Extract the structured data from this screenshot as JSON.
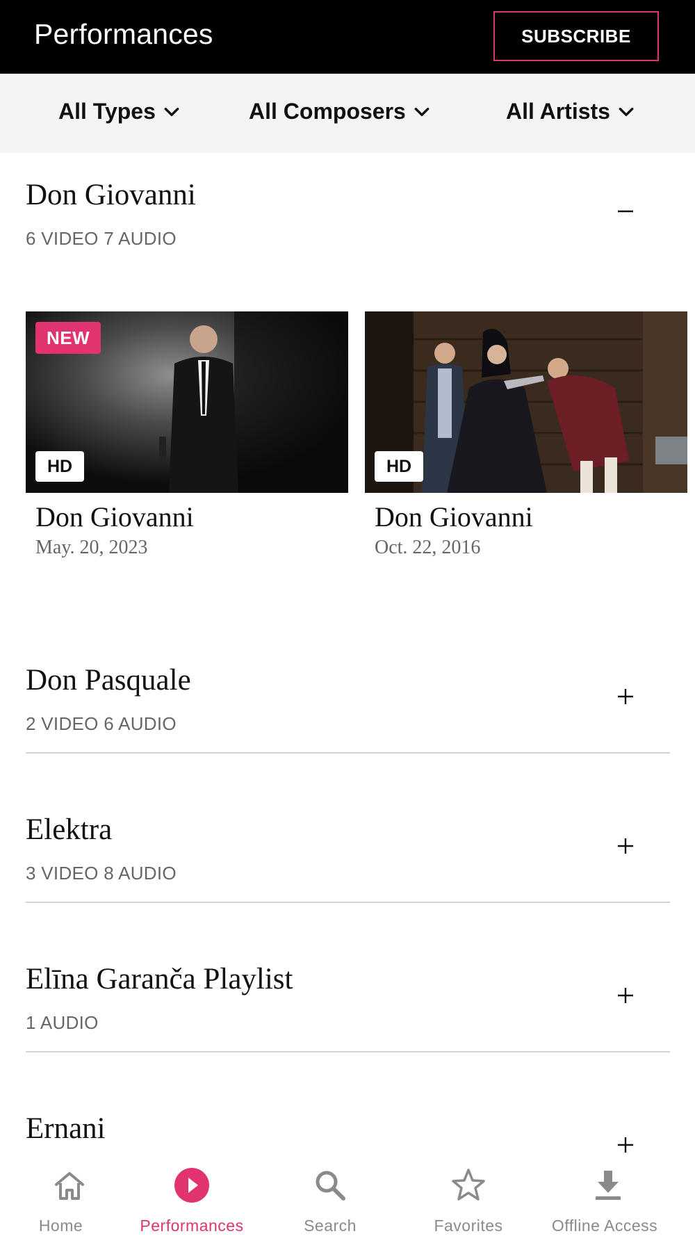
{
  "header": {
    "title": "Performances",
    "subscribe_label": "SUBSCRIBE"
  },
  "filters": [
    {
      "label": "All Types",
      "icon": "chevron-down-icon"
    },
    {
      "label": "All Composers",
      "icon": "chevron-down-icon"
    },
    {
      "label": "All Artists",
      "icon": "chevron-down-icon"
    }
  ],
  "sections": [
    {
      "title": "Don Giovanni",
      "subtitle": "6 VIDEO 7 AUDIO",
      "expanded": true,
      "toggle": "minus-icon",
      "cards": [
        {
          "badge_new": "NEW",
          "quality": "HD",
          "title": "Don Giovanni",
          "date": "May. 20, 2023"
        },
        {
          "quality": "HD",
          "title": "Don Giovanni",
          "date": "Oct. 22, 2016"
        }
      ]
    },
    {
      "title": "Don Pasquale",
      "subtitle": "2 VIDEO 6 AUDIO",
      "expanded": false,
      "toggle": "plus-icon"
    },
    {
      "title": "Elektra",
      "subtitle": "3 VIDEO 8 AUDIO",
      "expanded": false,
      "toggle": "plus-icon"
    },
    {
      "title": "Elīna Garanča Playlist",
      "subtitle": "1 AUDIO",
      "expanded": false,
      "toggle": "plus-icon"
    },
    {
      "title": "Ernani",
      "expanded": false,
      "toggle": "plus-icon"
    }
  ],
  "bottom_nav": [
    {
      "label": "Home",
      "icon": "home-icon",
      "active": false
    },
    {
      "label": "Performances",
      "icon": "play-circle-icon",
      "active": true
    },
    {
      "label": "Search",
      "icon": "search-icon",
      "active": false
    },
    {
      "label": "Favorites",
      "icon": "star-icon",
      "active": false
    },
    {
      "label": "Offline Access",
      "icon": "download-icon",
      "active": false
    }
  ],
  "colors": {
    "accent": "#e0336f",
    "header_bg": "#000000",
    "filter_bg": "#f4f4f4",
    "muted_text": "#666666",
    "nav_inactive": "#8a8a8a"
  }
}
